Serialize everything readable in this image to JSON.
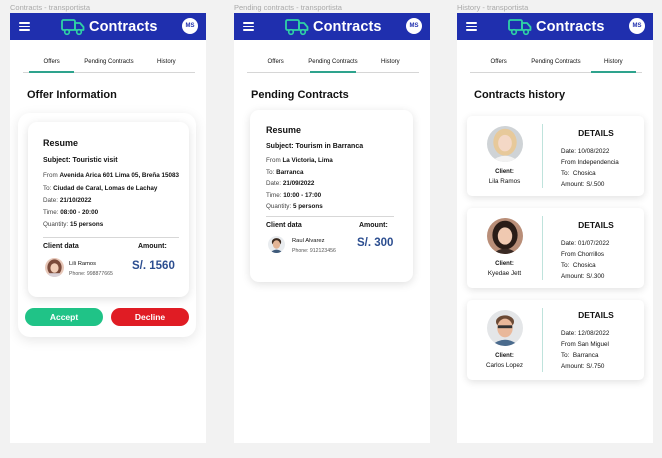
{
  "colors": {
    "appbar": "#1f2fae",
    "accent": "#2ea38d",
    "accept": "#20c387",
    "decline": "#e01c24",
    "amount": "#2b4d8f"
  },
  "frames": [
    {
      "label": "Contracts - transportista"
    },
    {
      "label": "Pending contracts - transportista"
    },
    {
      "label": "History - transportista"
    }
  ],
  "appbar": {
    "title": "Contracts",
    "avatar": "MS",
    "menu_icon": "hamburger-icon",
    "logo_icon": "truck-icon"
  },
  "tabs": [
    "Offers",
    "Pending Contracts",
    "History"
  ],
  "offer": {
    "section_title": "Offer Information",
    "card_title": "Resume",
    "subject": "Subject: Touristic visit",
    "from_label": "From",
    "from": "Avenida Arica 601 Lima 05, Breña 15083",
    "to_label": "To:",
    "to": "Ciudad de Caral, Lomas de Lachay",
    "date_label": "Date:",
    "date": "21/10/2022",
    "time_label": "Time:",
    "time": "08:00 - 20:00",
    "qty_label": "Quantity:",
    "qty": "15 persons",
    "client_data": "Client data",
    "amount_label": "Amount:",
    "client_name": "Lili Ramos",
    "client_phone": "Phone: 998877665",
    "amount": "S/. 1560",
    "accept": "Accept",
    "decline": "Decline"
  },
  "pending": {
    "section_title": "Pending Contracts",
    "card_title": "Resume",
    "subject": "Subject: Tourism in Barranca",
    "from_label": "From",
    "from": "La Victoria, Lima",
    "to_label": "To:",
    "to": "Barranca",
    "date_label": "Date:",
    "date": "21/09/2022",
    "time_label": "Time:",
    "time": "10:00 - 17:00",
    "qty_label": "Quantity:",
    "qty": "5 persons",
    "client_data": "Client data",
    "amount_label": "Amount:",
    "client_name": "Raul Alvarez",
    "client_phone": "Phone: 912123456",
    "amount": "S/. 300"
  },
  "history": {
    "section_title": "Contracts history",
    "client_label": "Client:",
    "details": "DETAILS",
    "date_label": "Date:",
    "from_label": "From",
    "to_label": "To:",
    "amount_label": "Amount:",
    "items": [
      {
        "client": "Lila Ramos",
        "date": "10/08/2022",
        "from": "Independencia",
        "to": "Chosica",
        "amount": "S/.500"
      },
      {
        "client": "Kyedae Jett",
        "date": "01/07/2022",
        "from": "Chorrillos",
        "to": "Chosica",
        "amount": "S/.300"
      },
      {
        "client": "Carlos Lopez",
        "date": "12/08/2022",
        "from": "San Miguel",
        "to": "Barranca",
        "amount": "S/.750"
      }
    ]
  }
}
